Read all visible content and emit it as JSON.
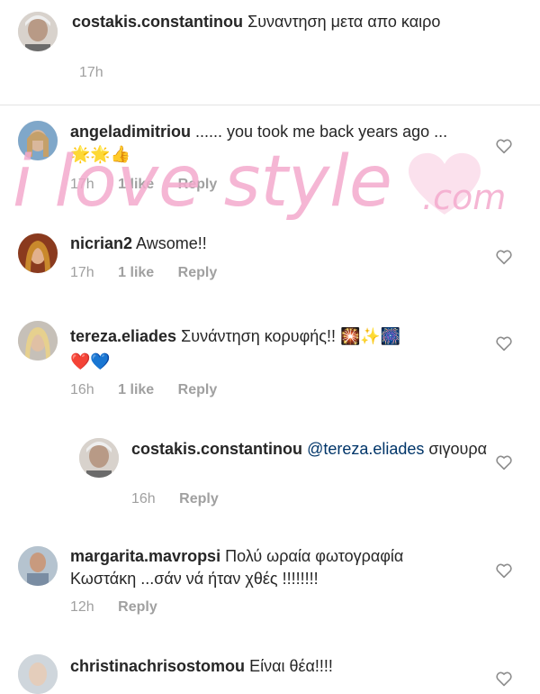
{
  "comments": [
    {
      "username": "costakis.constantinou",
      "text": "Συναντηση μετα απο καιρο",
      "time": "17h"
    },
    {
      "username": "angeladimitriou",
      "text": "...... you took me back years ago ...",
      "emoji": "🌟🌟👍",
      "time": "17h",
      "likes": "1 like",
      "reply": "Reply"
    },
    {
      "username": "nicrian2",
      "text": "Awsome!!",
      "time": "17h",
      "likes": "1 like",
      "reply": "Reply"
    },
    {
      "username": "tereza.eliades",
      "text": "Συνάντηση κορυφής!!",
      "emoji_inline": "🎇✨🎆",
      "emoji_line2": "❤️💙",
      "time": "16h",
      "likes": "1 like",
      "reply": "Reply"
    },
    {
      "username": "costakis.constantinou",
      "mention": "@tereza.eliades",
      "text": "σιγουρα",
      "time": "16h",
      "reply": "Reply"
    },
    {
      "username": "margarita.mavropsi",
      "text": "Πολύ ωραία φωτογραφία",
      "text_line2": "Κωστάκη ...σάν νά ήταν χθές !!!!!!!!",
      "time": "12h",
      "reply": "Reply"
    },
    {
      "username": "christinachrisostomou",
      "text": "Είναι θέα!!!!"
    }
  ],
  "watermark": {
    "text": "i love style",
    "suffix": ".com"
  },
  "colors": {
    "text": "#262626",
    "meta": "#a0a0a0",
    "mention": "#003569",
    "watermark": "#f3a9cc"
  }
}
